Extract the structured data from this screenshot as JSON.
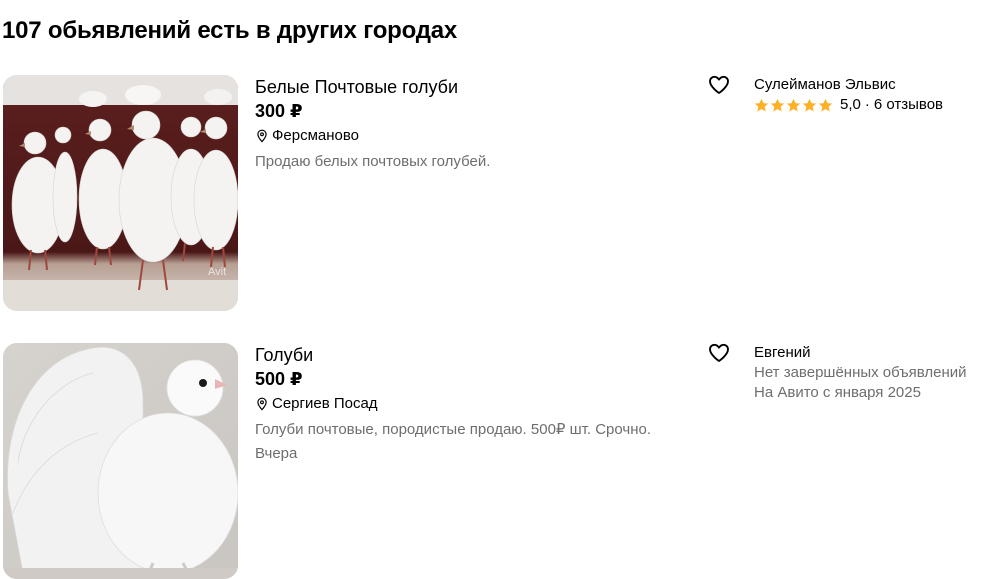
{
  "section": {
    "title": "107 обьявлений есть в других городах"
  },
  "listings": [
    {
      "title": "Белые Почтовые голуби",
      "price": "300 ₽",
      "location": "Ферсманово",
      "description": "Продаю белых почтовых голубей.",
      "watermark": "Avito",
      "seller": {
        "name": "Сулейманов Эльвис",
        "rating": "5,0",
        "reviews": "6 отзывов",
        "stars": 5
      }
    },
    {
      "title": "Голуби",
      "price": "500 ₽",
      "location": "Сергиев Посад",
      "description": "Голуби почтовые, породистые продаю. 500₽ шт. Срочно.",
      "date": "Вчера",
      "seller": {
        "name": "Евгений",
        "line1": "Нет завершённых объявлений",
        "line2": "На Авито с января 2025"
      }
    }
  ],
  "colors": {
    "star": "#ffb021",
    "muted_text": "#6e6e6e"
  },
  "icons": {
    "favorite": "heart-outline-icon",
    "location": "map-pin-icon",
    "rating": "star-icon"
  }
}
